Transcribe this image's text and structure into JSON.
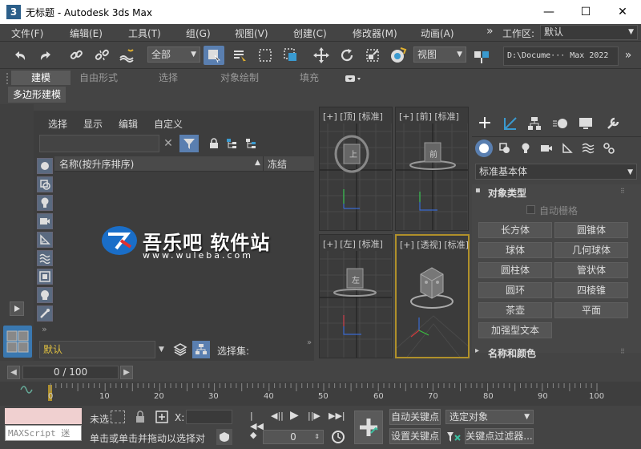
{
  "window": {
    "title": "无标题 - Autodesk 3ds Max",
    "app_icon": "3",
    "minimize": "—",
    "maximize": "☐",
    "close": "✕"
  },
  "menu": [
    "文件(F)",
    "编辑(E)",
    "工具(T)",
    "组(G)",
    "视图(V)",
    "创建(C)",
    "修改器(M)",
    "动画(A)"
  ],
  "menu_more": "»",
  "workspace": {
    "label": "工作区:",
    "value": "默认"
  },
  "toolbar": {
    "selection_filter": "全部",
    "ref_coord": "视图",
    "path": "D:\\Docume··· Max 2022"
  },
  "ribbon": {
    "tabs": [
      "建模",
      "自由形式",
      "选择",
      "对象绘制",
      "填充"
    ],
    "active": "建模",
    "subtab": "多边形建模"
  },
  "explorer": {
    "menus": [
      "选择",
      "显示",
      "编辑",
      "自定义"
    ],
    "columns": [
      "名称(按升序排序)",
      "冻结"
    ],
    "sort_arrow": "▲",
    "layer": "默认",
    "selection_set_label": "选择集:",
    "expand": "»"
  },
  "viewports": [
    {
      "label": "[+] [顶] [标准]",
      "cube": "上"
    },
    {
      "label": "[+] [前] [标准]",
      "cube": "前"
    },
    {
      "label": "[+] [左] [标准]",
      "cube": "左"
    },
    {
      "label": "[+] [透视] [标准]",
      "cube": ""
    }
  ],
  "watermark": {
    "title": "吾乐吧 软件站",
    "url": "www.wuleba.com"
  },
  "command_panel": {
    "category": "标准基本体",
    "rollout_object_type": "对象类型",
    "autogrid": "自动栅格",
    "buttons": [
      "长方体",
      "圆锥体",
      "球体",
      "几何球体",
      "圆柱体",
      "管状体",
      "圆环",
      "四棱锥",
      "茶壶",
      "平面",
      "加强型文本"
    ],
    "rollout_name_color": "名称和颜色"
  },
  "timeline": {
    "frame": "0 / 100",
    "ticks": [
      "0",
      "10",
      "20",
      "30",
      "40",
      "50",
      "60",
      "70",
      "80",
      "90",
      "100"
    ]
  },
  "status": {
    "maxscript": "MAXScript 迷",
    "unselected": "未选",
    "x_label": "X:",
    "prompt": "单击或单击并拖动以选择对",
    "frame_value": "0",
    "auto_key": "自动关键点",
    "set_key": "设置关键点",
    "selected_object": "选定对象",
    "key_filters": "关键点过滤器..."
  }
}
